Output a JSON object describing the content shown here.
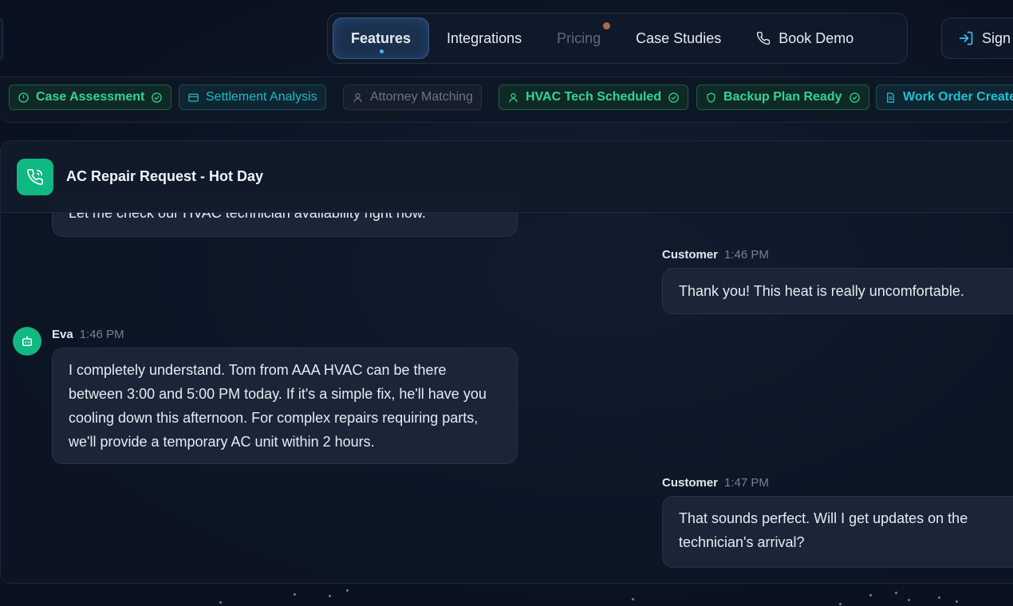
{
  "nav": {
    "items": [
      {
        "label": "Features",
        "active": true
      },
      {
        "label": "Integrations"
      },
      {
        "label": "Pricing",
        "dimmed": true
      },
      {
        "label": "Case Studies"
      },
      {
        "label": "Book Demo",
        "icon": "phone-icon"
      }
    ],
    "signin_label": "Sign"
  },
  "chips": [
    {
      "label": "Case Assessment",
      "style": "green",
      "lead_icon": "alert-circle-icon",
      "trail_icon": "check-circle-icon"
    },
    {
      "label": "Settlement Analysis",
      "style": "teal",
      "lead_icon": "card-icon"
    },
    {
      "label": "Attorney Matching",
      "style": "gray",
      "lead_icon": "user-icon"
    },
    {
      "label": "HVAC Tech Scheduled",
      "style": "green",
      "lead_icon": "user-icon",
      "trail_icon": "check-circle-icon"
    },
    {
      "label": "Backup Plan Ready",
      "style": "green",
      "lead_icon": "shield-icon",
      "trail_icon": "check-circle-icon"
    },
    {
      "label": "Work Order Create",
      "style": "cyan",
      "lead_icon": "document-icon"
    }
  ],
  "conversation": {
    "title": "AC Repair Request - Hot Day",
    "partial_message": "Let me check our HVAC technician availability right now.",
    "messages": [
      {
        "sender": "Customer",
        "time": "1:46 PM",
        "text": "Thank you! This heat is really uncomfortable."
      },
      {
        "sender": "Eva",
        "time": "1:46 PM",
        "text": "I completely understand. Tom from AAA HVAC can be there between 3:00 and 5:00 PM today. If it's a simple fix, he'll have you cooling down this afternoon. For complex repairs requiring parts, we'll provide a temporary AC unit within 2 hours."
      },
      {
        "sender": "Customer",
        "time": "1:47 PM",
        "text": "That sounds perfect. Will I get updates on the technician's arrival?"
      }
    ]
  },
  "colors": {
    "accent_green": "#10b981",
    "chip_green_text": "#34d399",
    "chip_teal_text": "#22b8c8",
    "nav_active_border": "#3a5a86"
  }
}
